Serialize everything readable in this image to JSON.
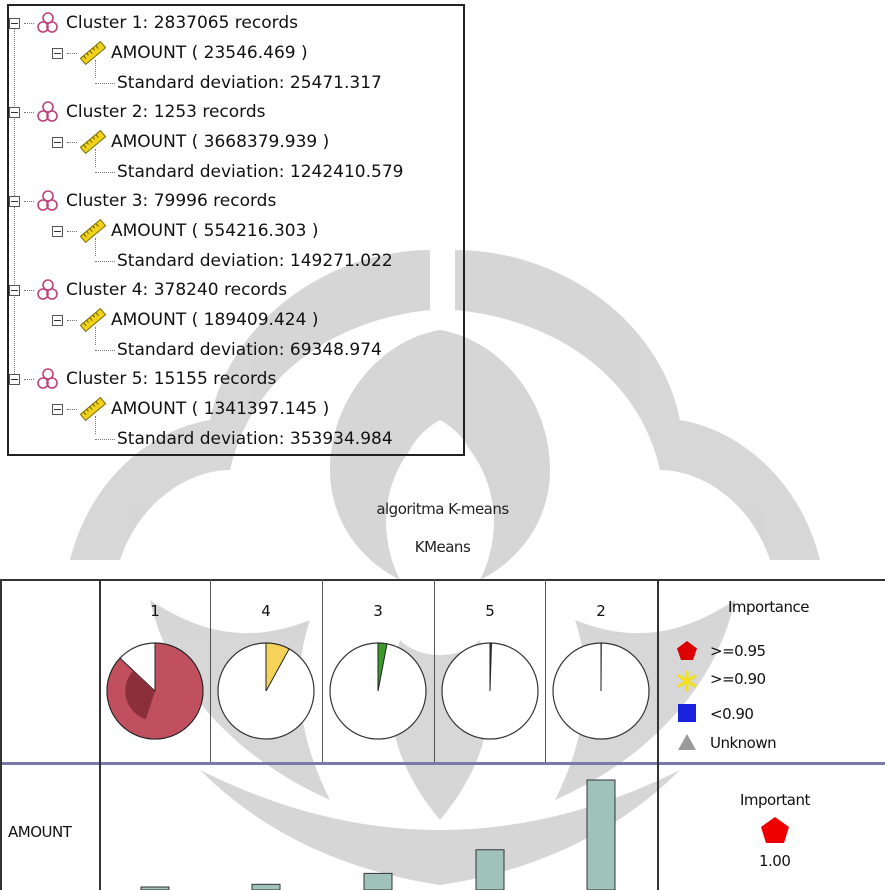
{
  "tree": {
    "clusters": [
      {
        "label": "Cluster 1: 2837065 records",
        "attribute": "AMOUNT ( 23546.469 )",
        "stddev": "Standard deviation: 25471.317"
      },
      {
        "label": "Cluster 2: 1253 records",
        "attribute": "AMOUNT ( 3668379.939 )",
        "stddev": "Standard deviation: 1242410.579"
      },
      {
        "label": "Cluster 3: 79996 records",
        "attribute": "AMOUNT ( 554216.303 )",
        "stddev": "Standard deviation: 149271.022"
      },
      {
        "label": "Cluster 4: 378240 records",
        "attribute": "AMOUNT ( 189409.424 )",
        "stddev": "Standard deviation: 69348.974"
      },
      {
        "label": "Cluster 5: 15155 records",
        "attribute": "AMOUNT ( 1341397.145 )",
        "stddev": "Standard deviation: 353934.984"
      }
    ]
  },
  "chart": {
    "title": "algoritma K-means",
    "subtitle": "KMeans",
    "columns": [
      "1",
      "4",
      "3",
      "5",
      "2"
    ],
    "pie_fractions": [
      0.87,
      0.08,
      0.03,
      0.005,
      0.001
    ],
    "legend_title": "Importance",
    "legend": [
      {
        "label": ">=0.95",
        "icon": "pentagon-icon",
        "color": "#dd0000"
      },
      {
        "label": ">=0.90",
        "icon": "star-icon",
        "color": "#f2e01a"
      },
      {
        "label": "<0.90",
        "icon": "square-icon",
        "color": "#1a22dd"
      },
      {
        "label": "Unknown",
        "icon": "triangle-icon",
        "color": "#9a9a9a"
      }
    ],
    "row_label": "AMOUNT",
    "importance_title": "Important",
    "importance_value": "1.00",
    "bar_values": [
      23546.469,
      189409.424,
      554216.303,
      1341397.145,
      3668379.939
    ],
    "colors": {
      "pie_cluster1": "#c0505e",
      "pie_cluster1_dark": "#8b2f3a",
      "pie_cluster4": "#f5d35a",
      "pie_cluster3": "#3a9a2a",
      "bar_fill": "#9fc3bb",
      "important_icon": "#ee0000"
    }
  }
}
